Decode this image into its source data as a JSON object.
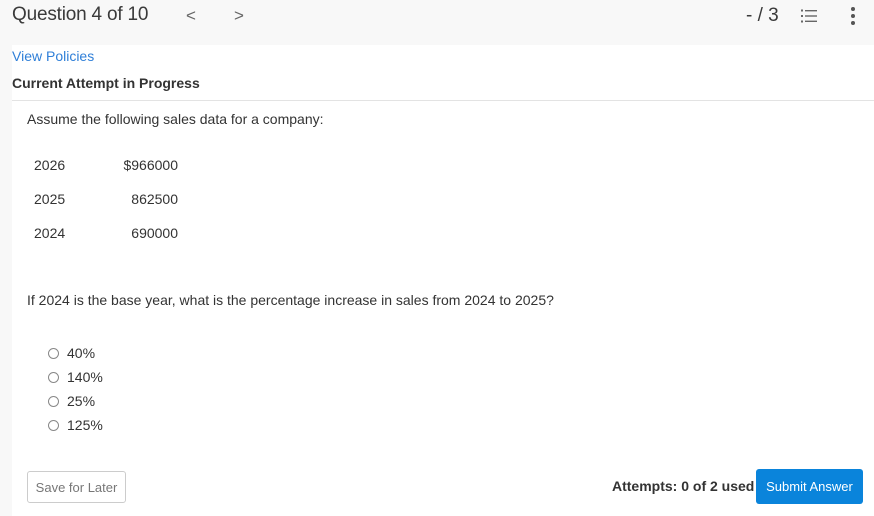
{
  "header": {
    "question_label": "Question 4 of 10",
    "prev_icon": "chevron-left-icon",
    "next_icon": "chevron-right-icon",
    "prev_glyph": "<",
    "next_glyph": ">",
    "score": "- / 3",
    "list_icon": "numbered-list-icon",
    "more_icon": "more-vertical-icon"
  },
  "panel": {
    "view_policies": "View Policies",
    "attempt_status": "Current Attempt in Progress"
  },
  "question": {
    "prompt": "Assume the following sales data for a company:",
    "sales": [
      {
        "year": "2026",
        "amount": "$966000"
      },
      {
        "year": "2025",
        "amount": "862500"
      },
      {
        "year": "2024",
        "amount": "690000"
      }
    ],
    "text": "If 2024 is the base year, what is the percentage increase in sales from 2024 to 2025?",
    "options": [
      {
        "label": "40%",
        "selected": false
      },
      {
        "label": "140%",
        "selected": false
      },
      {
        "label": "25%",
        "selected": false
      },
      {
        "label": "125%",
        "selected": false
      }
    ]
  },
  "footer": {
    "save_label": "Save for Later",
    "attempts": "Attempts: 0 of 2 used",
    "submit_label": "Submit Answer"
  },
  "colors": {
    "link": "#2f7fd8",
    "submit": "#0a84db",
    "header_bg": "#f8f8f8"
  }
}
